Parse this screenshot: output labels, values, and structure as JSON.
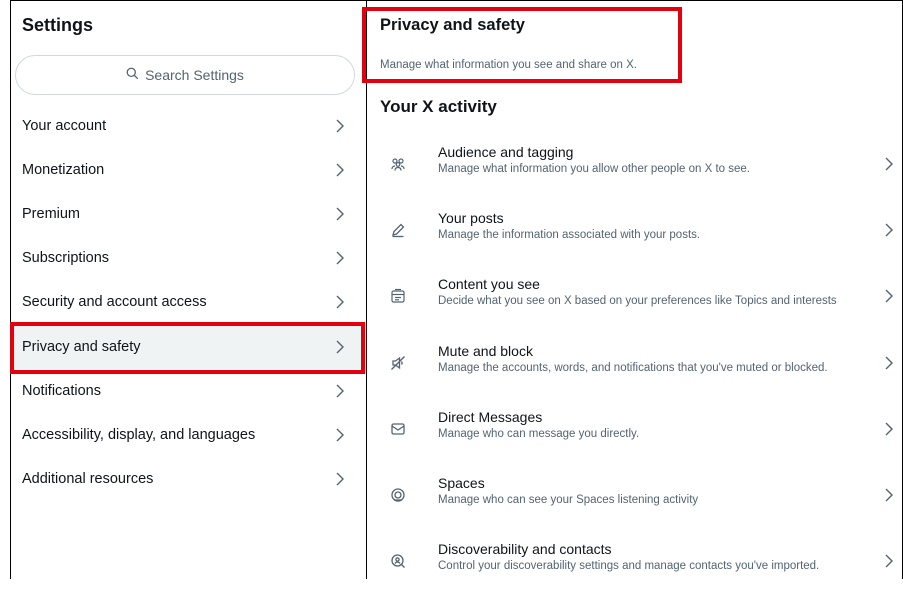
{
  "sidebar": {
    "title": "Settings",
    "search_placeholder": "Search Settings",
    "items": [
      {
        "label": "Your account"
      },
      {
        "label": "Monetization"
      },
      {
        "label": "Premium"
      },
      {
        "label": "Subscriptions"
      },
      {
        "label": "Security and account access"
      },
      {
        "label": "Privacy and safety",
        "active": true
      },
      {
        "label": "Notifications"
      },
      {
        "label": "Accessibility, display, and languages"
      },
      {
        "label": "Additional resources"
      }
    ]
  },
  "main": {
    "title": "Privacy and safety",
    "subtitle": "Manage what information you see and share on X.",
    "section_title": "Your X activity",
    "rows": [
      {
        "title": "Audience and tagging",
        "subtitle": "Manage what information you allow other people on X to see.",
        "icon": "people-icon"
      },
      {
        "title": "Your posts",
        "subtitle": "Manage the information associated with your posts.",
        "icon": "pencil-icon"
      },
      {
        "title": "Content you see",
        "subtitle": "Decide what you see on X based on your preferences like Topics and interests",
        "icon": "content-icon"
      },
      {
        "title": "Mute and block",
        "subtitle": "Manage the accounts, words, and notifications that you've muted or blocked.",
        "icon": "mute-icon"
      },
      {
        "title": "Direct Messages",
        "subtitle": "Manage who can message you directly.",
        "icon": "envelope-icon"
      },
      {
        "title": "Spaces",
        "subtitle": "Manage who can see your Spaces listening activity",
        "icon": "spaces-icon"
      },
      {
        "title": "Discoverability and contacts",
        "subtitle": "Control your discoverability settings and manage contacts you've imported.",
        "icon": "discover-icon"
      }
    ]
  },
  "colors": {
    "highlight": "#e3000f",
    "text": "#0f1419",
    "muted": "#536471",
    "border": "#cfd9de"
  }
}
